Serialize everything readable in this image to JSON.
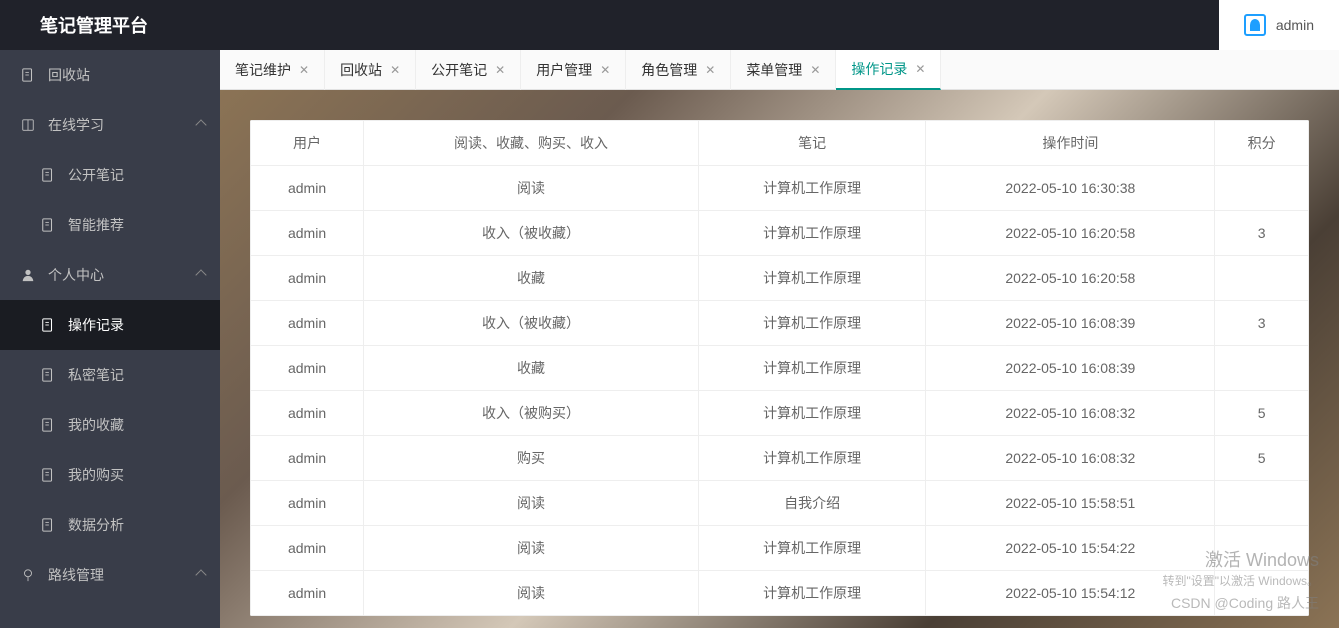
{
  "app_title": "笔记管理平台",
  "user": {
    "name": "admin"
  },
  "sidebar": {
    "items": [
      {
        "label": "回收站",
        "type": "item",
        "sub": false
      },
      {
        "label": "在线学习",
        "type": "group"
      },
      {
        "label": "公开笔记",
        "type": "item",
        "sub": true
      },
      {
        "label": "智能推荐",
        "type": "item",
        "sub": true
      },
      {
        "label": "个人中心",
        "type": "group"
      },
      {
        "label": "操作记录",
        "type": "item",
        "sub": true,
        "active": true
      },
      {
        "label": "私密笔记",
        "type": "item",
        "sub": true
      },
      {
        "label": "我的收藏",
        "type": "item",
        "sub": true
      },
      {
        "label": "我的购买",
        "type": "item",
        "sub": true
      },
      {
        "label": "数据分析",
        "type": "item",
        "sub": true
      },
      {
        "label": "路线管理",
        "type": "group-collapsed"
      }
    ]
  },
  "tabs": [
    {
      "label": "笔记维护",
      "closable": true
    },
    {
      "label": "回收站",
      "closable": true
    },
    {
      "label": "公开笔记",
      "closable": true
    },
    {
      "label": "用户管理",
      "closable": true
    },
    {
      "label": "角色管理",
      "closable": true
    },
    {
      "label": "菜单管理",
      "closable": true
    },
    {
      "label": "操作记录",
      "closable": true,
      "active": true
    }
  ],
  "table": {
    "headers": [
      "用户",
      "阅读、收藏、购买、收入",
      "笔记",
      "操作时间",
      "积分"
    ],
    "rows": [
      {
        "user": "admin",
        "action": "阅读",
        "note": "计算机工作原理",
        "time": "2022-05-10 16:30:38",
        "points": ""
      },
      {
        "user": "admin",
        "action": "收入（被收藏）",
        "note": "计算机工作原理",
        "time": "2022-05-10 16:20:58",
        "points": "3"
      },
      {
        "user": "admin",
        "action": "收藏",
        "note": "计算机工作原理",
        "time": "2022-05-10 16:20:58",
        "points": ""
      },
      {
        "user": "admin",
        "action": "收入（被收藏）",
        "note": "计算机工作原理",
        "time": "2022-05-10 16:08:39",
        "points": "3"
      },
      {
        "user": "admin",
        "action": "收藏",
        "note": "计算机工作原理",
        "time": "2022-05-10 16:08:39",
        "points": ""
      },
      {
        "user": "admin",
        "action": "收入（被购买）",
        "note": "计算机工作原理",
        "time": "2022-05-10 16:08:32",
        "points": "5"
      },
      {
        "user": "admin",
        "action": "购买",
        "note": "计算机工作原理",
        "time": "2022-05-10 16:08:32",
        "points": "5"
      },
      {
        "user": "admin",
        "action": "阅读",
        "note": "自我介绍",
        "time": "2022-05-10 15:58:51",
        "points": ""
      },
      {
        "user": "admin",
        "action": "阅读",
        "note": "计算机工作原理",
        "time": "2022-05-10 15:54:22",
        "points": ""
      },
      {
        "user": "admin",
        "action": "阅读",
        "note": "计算机工作原理",
        "time": "2022-05-10 15:54:12",
        "points": ""
      }
    ]
  },
  "watermark": {
    "line1": "激活 Windows",
    "line2": "转到\"设置\"以激活 Windows。",
    "line3": "CSDN @Coding 路人王"
  }
}
